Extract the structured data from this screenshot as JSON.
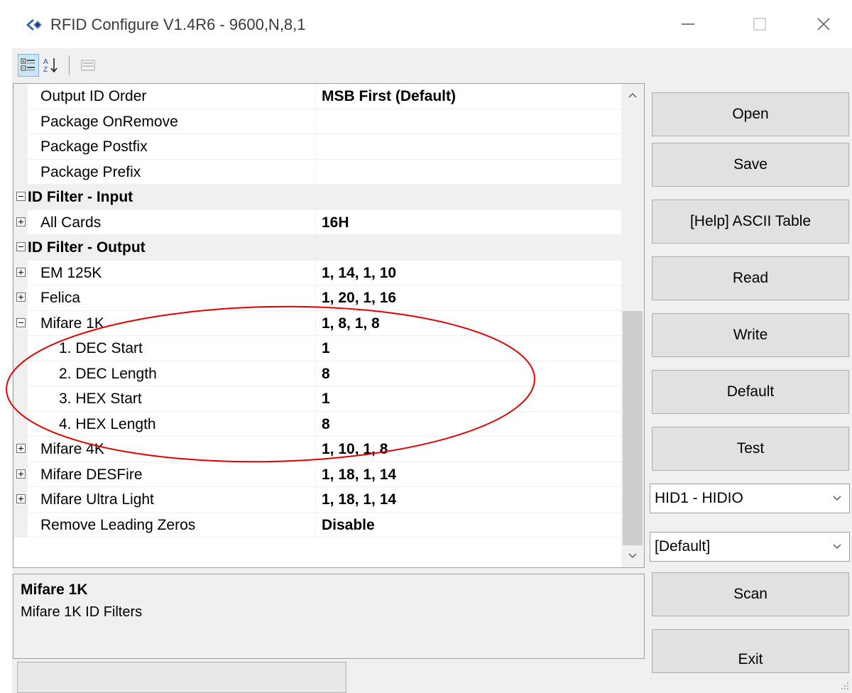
{
  "window": {
    "title": "RFID Configure V1.4R6 - 9600,N,8,1",
    "icon": "rfid-app-icon"
  },
  "toolbar": {
    "categorized_icon": "categorized-view-icon",
    "alphabetical_icon": "alphabetical-sort-icon",
    "property_pages_icon": "property-pages-icon"
  },
  "grid": {
    "rows": [
      {
        "name": "Output ID Order",
        "value": "MSB First (Default)",
        "type": "prop",
        "indent": 1
      },
      {
        "name": "Package OnRemove",
        "value": "",
        "type": "prop",
        "indent": 1
      },
      {
        "name": "Package Postfix",
        "value": "",
        "type": "prop",
        "indent": 1
      },
      {
        "name": "Package Prefix",
        "value": "",
        "type": "prop",
        "indent": 1
      },
      {
        "name": "ID Filter - Input",
        "value": "",
        "type": "category",
        "expander": "minus"
      },
      {
        "name": "All Cards",
        "value": "16H",
        "type": "prop",
        "expander": "plus",
        "indent": 1
      },
      {
        "name": "ID Filter - Output",
        "value": "",
        "type": "category",
        "expander": "minus"
      },
      {
        "name": "EM 125K",
        "value": "1, 14, 1, 10",
        "type": "prop",
        "expander": "plus",
        "indent": 1
      },
      {
        "name": "Felica",
        "value": "1, 20, 1, 16",
        "type": "prop",
        "expander": "plus",
        "indent": 1
      },
      {
        "name": "Mifare 1K",
        "value": "1, 8, 1, 8",
        "type": "prop",
        "expander": "minus",
        "indent": 1
      },
      {
        "name": "1. DEC Start",
        "value": "1",
        "type": "prop",
        "indent": 2
      },
      {
        "name": "2. DEC Length",
        "value": "8",
        "type": "prop",
        "indent": 2
      },
      {
        "name": "3. HEX Start",
        "value": "1",
        "type": "prop",
        "indent": 2
      },
      {
        "name": "4. HEX Length",
        "value": "8",
        "type": "prop",
        "indent": 2
      },
      {
        "name": "Mifare 4K",
        "value": "1, 10, 1, 8",
        "type": "prop",
        "expander": "plus",
        "indent": 1
      },
      {
        "name": "Mifare DESFire",
        "value": "1, 18, 1, 14",
        "type": "prop",
        "expander": "plus",
        "indent": 1
      },
      {
        "name": "Mifare Ultra Light",
        "value": "1, 18, 1, 14",
        "type": "prop",
        "expander": "plus",
        "indent": 1
      },
      {
        "name": "Remove Leading Zeros",
        "value": "Disable",
        "type": "prop",
        "indent": 1
      }
    ]
  },
  "help": {
    "title": "Mifare 1K",
    "description": "Mifare 1K ID Filters"
  },
  "buttons": {
    "open": "Open",
    "save": "Save",
    "ascii": "[Help] ASCII Table",
    "read": "Read",
    "write": "Write",
    "default": "Default",
    "test": "Test",
    "scan": "Scan",
    "exit": "Exit"
  },
  "selects": {
    "device": "HID1 - HIDIO",
    "profile": "[Default]"
  },
  "colors": {
    "annotation_ellipse": "#e00000",
    "window_bg": "#f0f0f0",
    "button_bg": "#e1e1e1"
  }
}
